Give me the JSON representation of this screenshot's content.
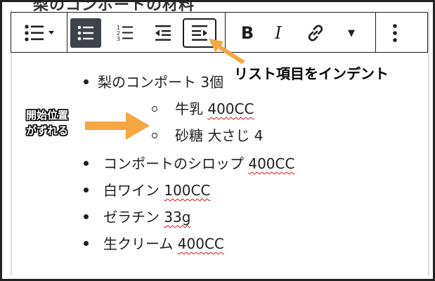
{
  "heading_cut": "梨のコンポートの材料",
  "toolbar": {
    "list_type_icon": "list-bullets-icon",
    "buttons": {
      "unordered": "unordered-list-icon",
      "ordered": "ordered-list-icon",
      "outdent": "outdent-icon",
      "indent": "indent-icon",
      "bold": "B",
      "italic": "I",
      "link": "link-icon",
      "more": "▼",
      "options": "more-options-icon"
    }
  },
  "list": {
    "item1": "梨のコンポート 3個",
    "sub1_text": "牛乳 ",
    "sub1_amount": "400CC",
    "sub2": "砂糖 大さじ 4",
    "item2_text": "コンポートのシロップ ",
    "item2_amount": "400CC",
    "item3_text": "白ワイン ",
    "item3_amount": "100CC",
    "item4_text": "ゼラチン ",
    "item4_amount": "33g",
    "item5_text": "生クリーム ",
    "item5_amount": "400CC"
  },
  "annotations": {
    "indent_label": "リスト項目をインデント",
    "start_line1": "開始位置",
    "start_line2": "がずれる"
  },
  "colors": {
    "accent_arrow": "#f5a742",
    "active_button": "#3c434a",
    "spellcheck": "#dd1111"
  }
}
